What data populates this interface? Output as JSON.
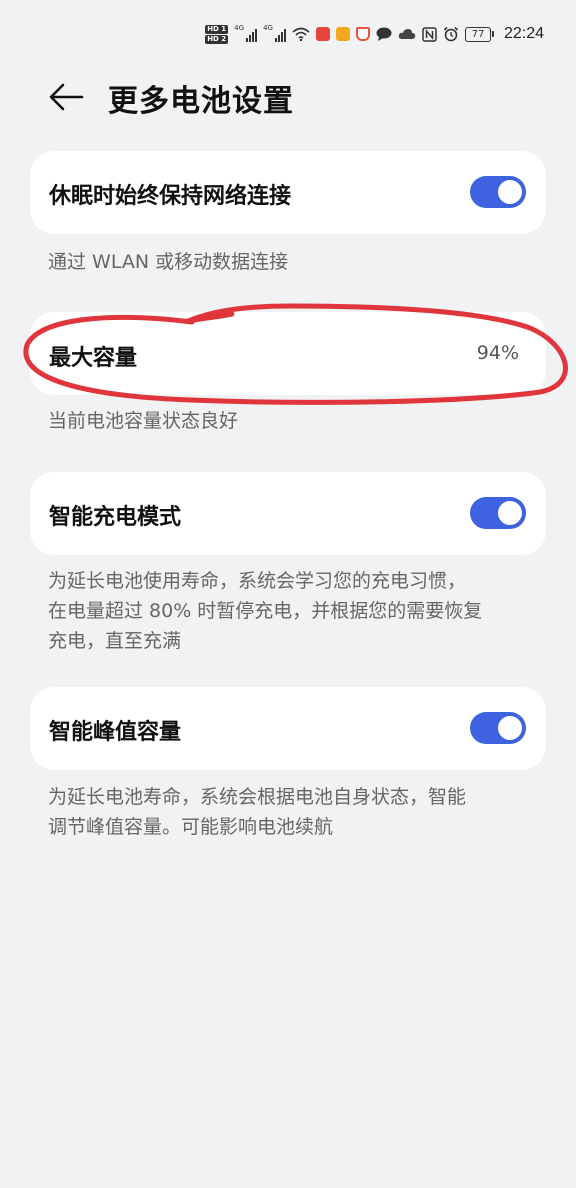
{
  "status_bar": {
    "hd1": "HD 1",
    "hd2": "HD 2",
    "net1": "4G",
    "net2": "4G",
    "battery_level": "77",
    "time": "22:24",
    "icons": [
      "signal-icon",
      "wifi-icon",
      "app-notification-icon",
      "message-icon",
      "cloud-icon",
      "nfc-icon",
      "alarm-icon",
      "battery-icon"
    ]
  },
  "header": {
    "title": "更多电池设置"
  },
  "settings": {
    "network": {
      "label": "休眠时始终保持网络连接",
      "enabled": true,
      "desc": "通过 WLAN 或移动数据连接"
    },
    "capacity": {
      "label": "最大容量",
      "value": "94%",
      "desc": "当前电池容量状态良好"
    },
    "smart_charge": {
      "label": "智能充电模式",
      "enabled": true,
      "desc_line1": "为延长电池使用寿命，系统会学习您的充电习惯，",
      "desc_line2": "在电量超过 80% 时暂停充电，并根据您的需要恢复",
      "desc_line3": "充电，直至充满"
    },
    "peak_capacity": {
      "label": "智能峰值容量",
      "enabled": true,
      "desc_line1": "为延长电池寿命，系统会根据电池自身状态，智能",
      "desc_line2": "调节峰值容量。可能影响电池续航"
    }
  },
  "colors": {
    "background": "#f1f2f4",
    "toggle_on": "#3f63e0",
    "annotation": "#e0353b"
  }
}
